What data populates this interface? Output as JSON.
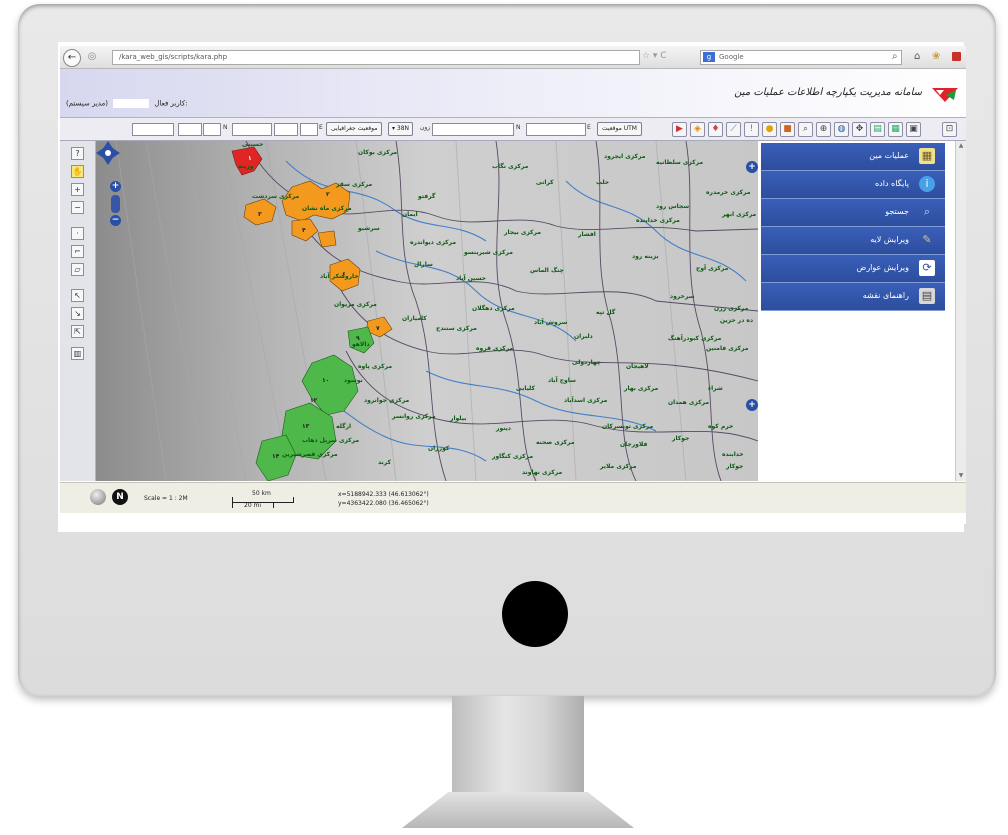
{
  "browser": {
    "url": "/kara_web_gis/scripts/kara.php",
    "search_engine": "Google",
    "back_icon": "back-arrow-icon",
    "home_icon": "home-icon"
  },
  "header": {
    "org_title": "سامانه مدیریت یکپارچه اطلاعات عملیات مین",
    "user_label": "کاربر فعال:",
    "user_role": "(مدیر سیستم)"
  },
  "toolbar": {
    "utm_button": "موقعیت UTM",
    "geo_button": "موقعیت جغرافیایی",
    "zone_label": "زون",
    "zone_value": "38N",
    "e_label": "E",
    "n_label": "N"
  },
  "sidebar": {
    "items": [
      {
        "label": "عملیات مین",
        "icon": "map-icon",
        "color": "#f0e08a"
      },
      {
        "label": "پایگاه داده",
        "icon": "info-icon",
        "color": "#4aa0e8"
      },
      {
        "label": "جستجو",
        "icon": "search-icon",
        "color": "#8ec6f0"
      },
      {
        "label": "ویرایش لایه",
        "icon": "layer-edit-icon",
        "color": "#c9a060"
      },
      {
        "label": "ویرایش عوارض",
        "icon": "feature-edit-icon",
        "color": "#7fb0ff"
      },
      {
        "label": "راهنمای نقشه",
        "icon": "legend-icon",
        "color": "#d8d8d8"
      }
    ]
  },
  "map": {
    "labels": [
      "حسینی",
      "مرکزی بوکان",
      "مرکزی نگاب",
      "مرکزی ایجرود",
      "مرکزی سلطانیه",
      "مرکزی خرمدره",
      "وزینه",
      "مرکزی سقز",
      "گرفتو",
      "کرانی",
      "حلب",
      "مرکزی سردشت",
      "ایمان",
      "مرکزی ماه نشان",
      "سجاس رود",
      "مرکزی ابهر",
      "مرکزی خدابنده",
      "سرشیو",
      "مرکزی دیواندره",
      "مرکزی بیجار",
      "افشار",
      "سارال",
      "مرکزی شیرینسو",
      "بزینه رود",
      "مرکزی آوج",
      "خاروشکر آباد",
      "حسین آباد",
      "چنگ الماس",
      "مرکزی مریوان",
      "مرکزی دهگلان",
      "گل تپه",
      "سرخرود",
      "مرکزی رزن",
      "کامیاران",
      "مرکزی سنندج",
      "سروش آباد",
      "مرکزی کبودرآهنگ",
      "دلبران",
      "مرکزی فامنین",
      "دالاهو",
      "مرکزی قروه",
      "چهاردولی",
      "لاهیجان",
      "ساوج آباد",
      "بیلوار",
      "کوزران",
      "جوکار",
      "خدابنده",
      "مرکزی همدان",
      "شراء",
      "مرکزی اسدآباد",
      "مرکزی بهار",
      "مرکزی تویسرکان",
      "فلاورجان",
      "مرکزی جوانرود",
      "مرکزی روانسر",
      "مرکزی پاوه",
      "نوسود",
      "ازگله",
      "مرکزی سرپل ذهاب",
      "مرکزی قصرشیرین",
      "کرند",
      "کلیایی",
      "دینور",
      "مرکزی صحنه",
      "مرکزی کنگاور",
      "مرکزی نهاوند",
      "مرکزی ملایر",
      "خرم کوه",
      "جوکار",
      "ده در حزین",
      "۱",
      "۲",
      "۳",
      "۴",
      "۶",
      "۷",
      "۹",
      "۱۰",
      "۱۲",
      "۱۳",
      "۱۴"
    ],
    "region_colors": {
      "high": "#e02525",
      "medium": "#f39a1e",
      "low": "#4fb84a"
    }
  },
  "status": {
    "scale_label": "Scale = 1 : 2M",
    "scale_km": "50 km",
    "scale_mi": "20 mi",
    "x_coord": "x=5188942.333 (46.613062°)",
    "y_coord": "y=4363422.080 (36.465062°)"
  }
}
